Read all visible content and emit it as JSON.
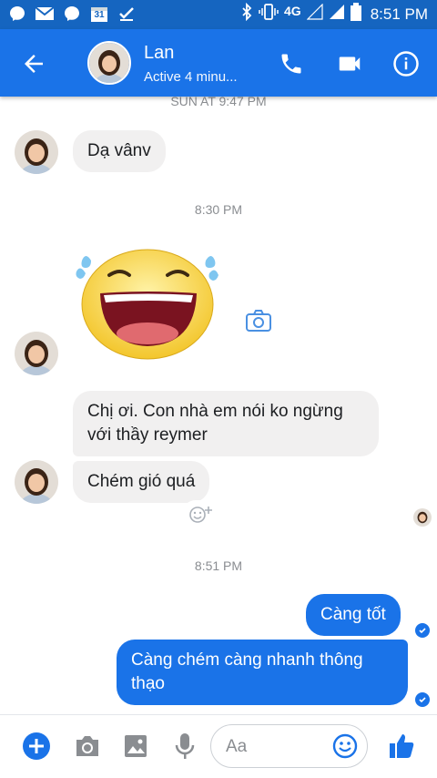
{
  "statusbar": {
    "network": "4G",
    "time": "8:51 PM",
    "calendar_day": "31",
    "icons": [
      "messenger-icon",
      "gmail-icon",
      "messenger-icon",
      "calendar-icon",
      "checkmark-icon",
      "bluetooth-icon",
      "vibrate-icon",
      "signal-icon",
      "battery-icon"
    ]
  },
  "header": {
    "contact_name": "Lan",
    "contact_status": "Active 4 minu...",
    "icons": [
      "back-arrow-icon",
      "phone-icon",
      "video-camera-icon",
      "info-icon"
    ]
  },
  "thread": {
    "timestamps": [
      "SUN AT 9:47 PM",
      "8:30 PM",
      "8:51 PM"
    ],
    "messages": [
      {
        "from": "Lan",
        "text": "Dạ vânv"
      },
      {
        "from": "Lan",
        "sticker": "laughing-face-sticker"
      },
      {
        "from": "Lan",
        "text": "Chị ơi. Con nhà em nói ko ngừng với thầy reymer"
      },
      {
        "from": "Lan",
        "text": "Chém gió quá"
      },
      {
        "from": "me",
        "text": "Càng tốt"
      },
      {
        "from": "me",
        "text": "Càng chém càng nhanh thông thạo"
      }
    ]
  },
  "composer": {
    "placeholder": "Aa",
    "icons": [
      "plus-icon",
      "camera-icon",
      "image-icon",
      "microphone-icon",
      "emoji-icon",
      "thumbs-up-icon"
    ]
  },
  "colors": {
    "accent": "#1a73e8",
    "statusbar": "#1565c0",
    "bubble_in": "#f1f0f0"
  }
}
